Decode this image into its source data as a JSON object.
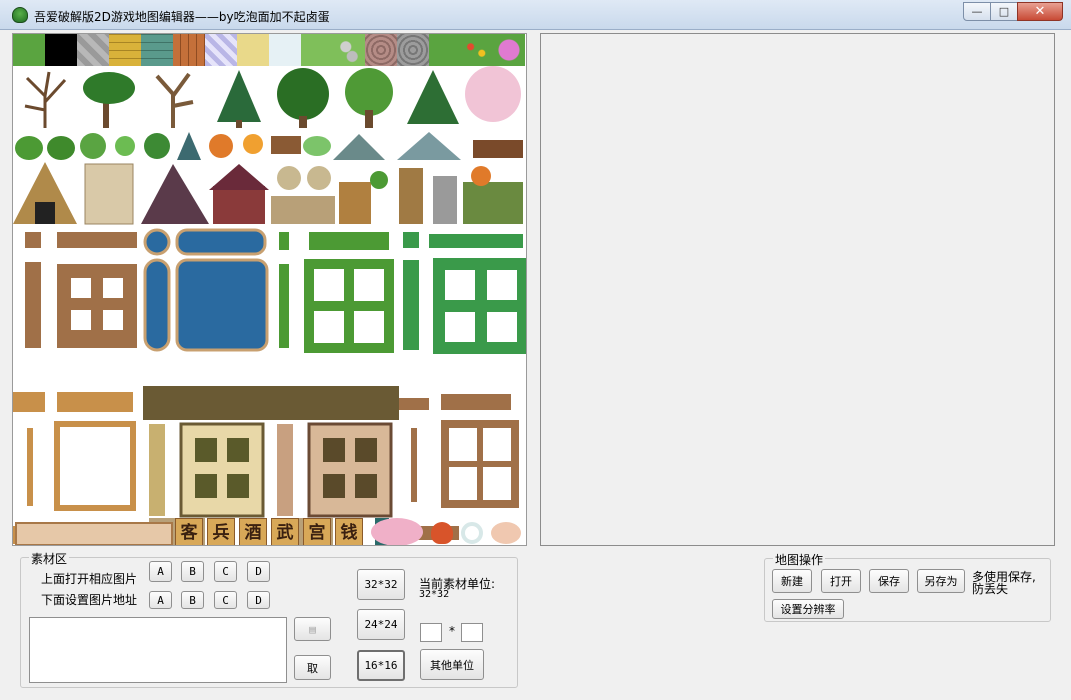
{
  "window": {
    "title": "吾爱破解版2D游戏地图编辑器——by吃泡面加不起卤蛋",
    "minimize_glyph": "—",
    "maximize_glyph": "□",
    "close_glyph": "✕"
  },
  "palette_sign_chars": [
    "客",
    "兵",
    "酒",
    "武",
    "宫",
    "钱"
  ],
  "material_group": {
    "title": "素材区",
    "open_label": "上面打开相应图片",
    "set_label": "下面设置图片地址",
    "open_buttons": [
      "A",
      "B",
      "C",
      "D"
    ],
    "set_buttons": [
      "A",
      "B",
      "C",
      "D"
    ],
    "icon_button_glyph": "▤",
    "take_button": "取",
    "size_32": "32*32",
    "size_24": "24*24",
    "size_16": "16*16",
    "current_unit_label": "当前素材单位:",
    "current_unit_value": "32*32",
    "times_sign": "*",
    "other_unit_button": "其他单位"
  },
  "map_group": {
    "title": "地图操作",
    "new_button": "新建",
    "open_button": "打开",
    "save_button": "保存",
    "save_as_button": "另存为",
    "note_line1": "多使用保存,",
    "note_line2": "防丢失",
    "resolution_button": "设置分辨率"
  },
  "colors": {
    "titlebar": "#c9d9ec",
    "close_button": "#c84a35",
    "panel_bg": "#f0f0f0"
  }
}
